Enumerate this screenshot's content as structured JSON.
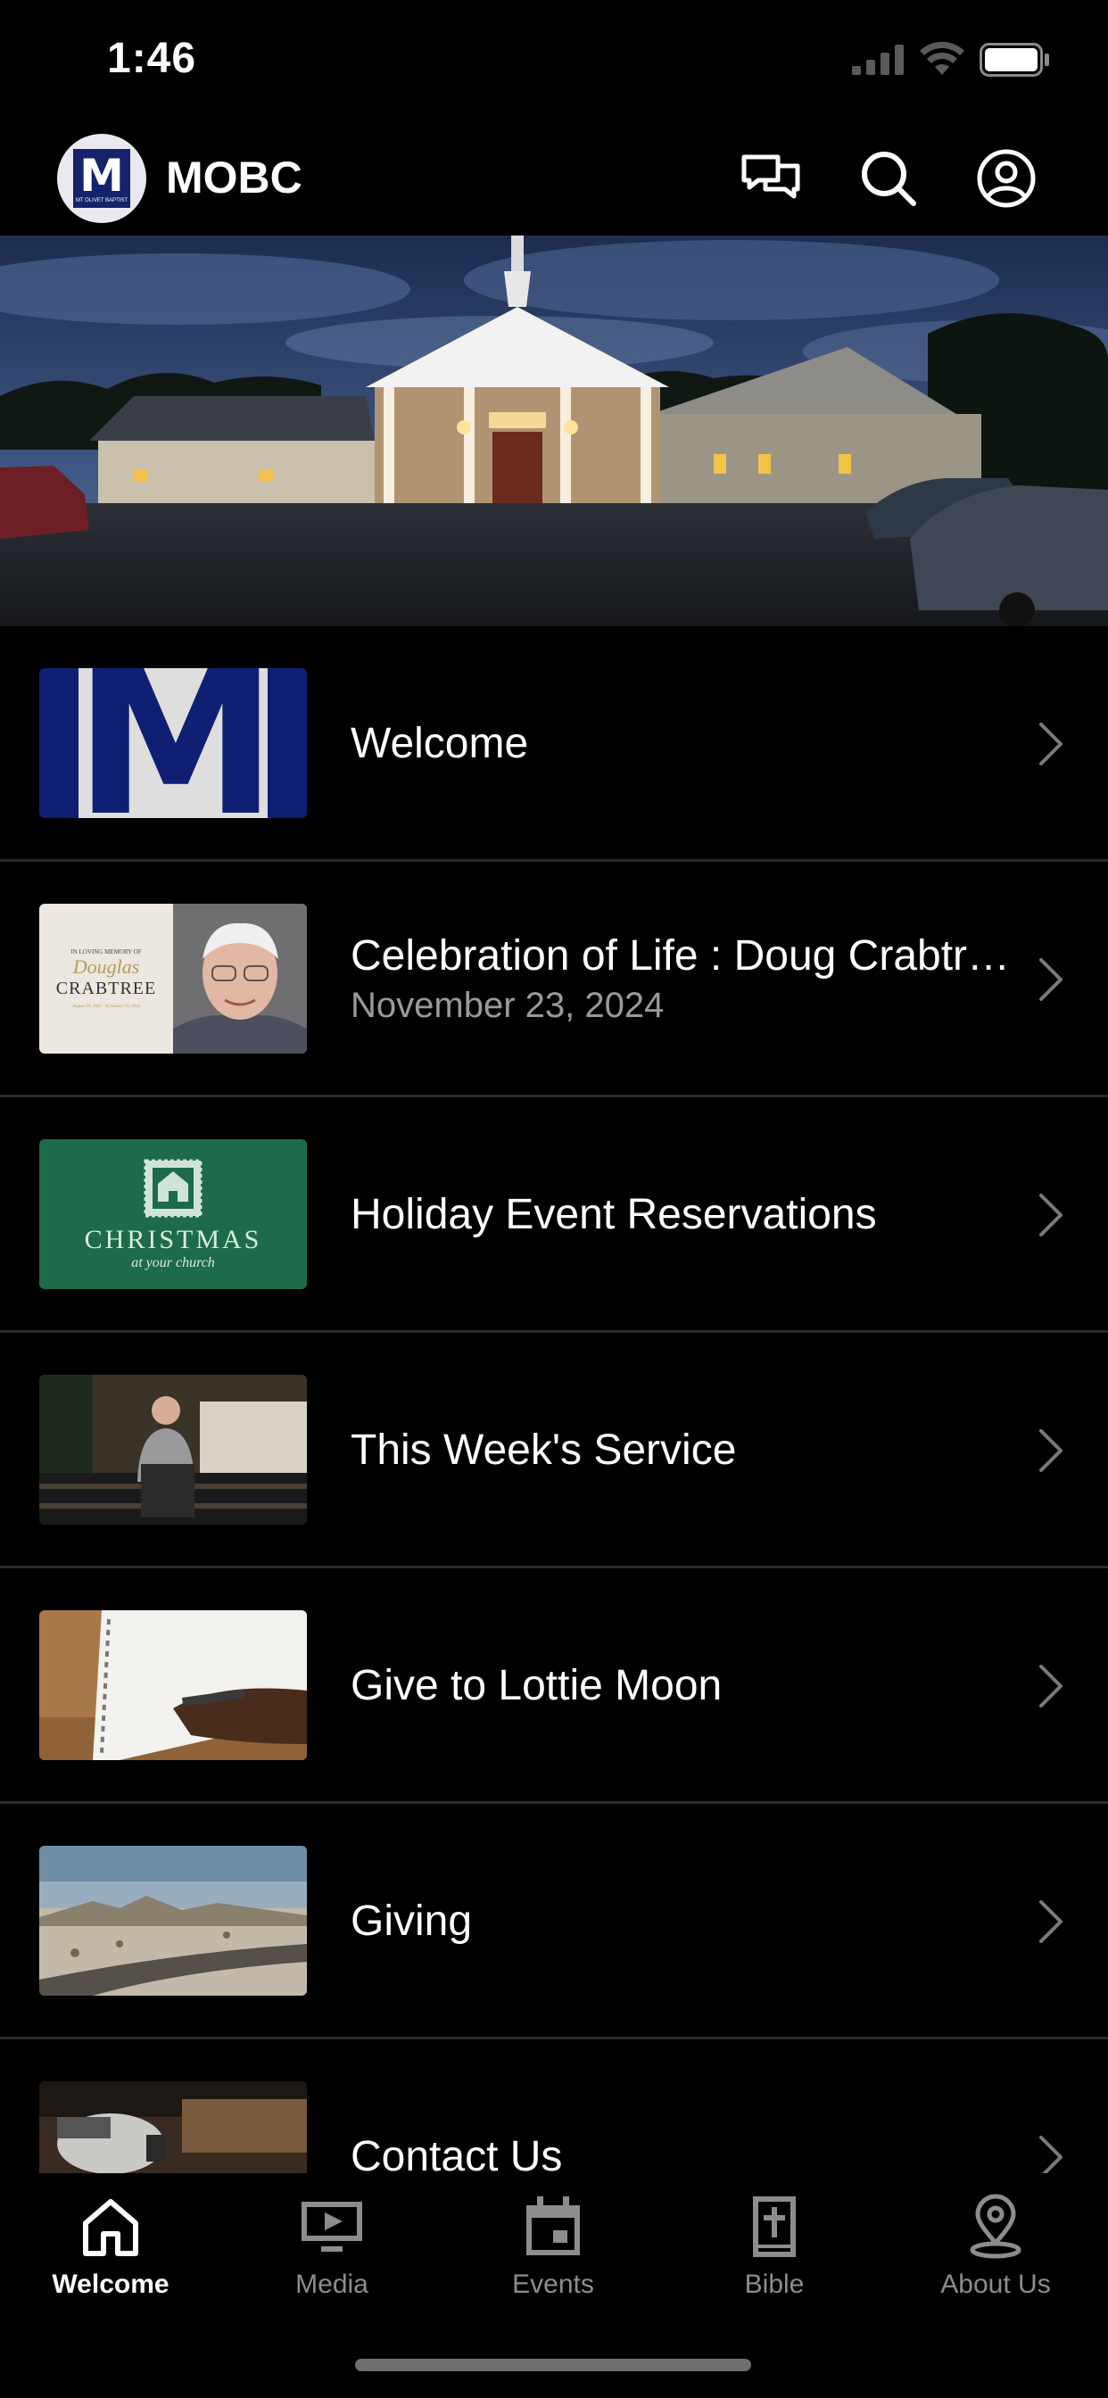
{
  "status": {
    "time": "1:46"
  },
  "header": {
    "title": "MOBC",
    "logo_letter": "M",
    "logo_subtext": "MT OLIVET BAPTIST"
  },
  "list_items": [
    {
      "title": "Welcome",
      "subtitle": ""
    },
    {
      "title": "Celebration of Life : Doug Crabtree",
      "subtitle": "November 23, 2024"
    },
    {
      "title": "Holiday Event Reservations",
      "subtitle": ""
    },
    {
      "title": "This Week's Service",
      "subtitle": ""
    },
    {
      "title": "Give to Lottie Moon",
      "subtitle": ""
    },
    {
      "title": "Giving",
      "subtitle": ""
    },
    {
      "title": "Contact Us",
      "subtitle": ""
    }
  ],
  "thumbs": {
    "welcome_letter": "M",
    "memorial_line1": "IN LOVING MEMORY OF",
    "memorial_script": "Douglas",
    "memorial_name": "CRABTREE",
    "memorial_dates": "August 30, 1945 - November 19, 2024",
    "christmas_title": "CHRISTMAS",
    "christmas_sub": "at your church"
  },
  "tabs": [
    {
      "label": "Welcome",
      "icon": "home-icon",
      "active": true
    },
    {
      "label": "Media",
      "icon": "tv-play-icon",
      "active": false
    },
    {
      "label": "Events",
      "icon": "calendar-icon",
      "active": false
    },
    {
      "label": "Bible",
      "icon": "bible-icon",
      "active": false
    },
    {
      "label": "About Us",
      "icon": "location-pin-icon",
      "active": false
    }
  ],
  "colors": {
    "background": "#000000",
    "active_tab": "#ffffff",
    "inactive_tab": "#8d8d8d",
    "subtitle": "#9a9a9a",
    "brand_navy": "#14236b",
    "christmas_green": "#1d6b4a"
  }
}
